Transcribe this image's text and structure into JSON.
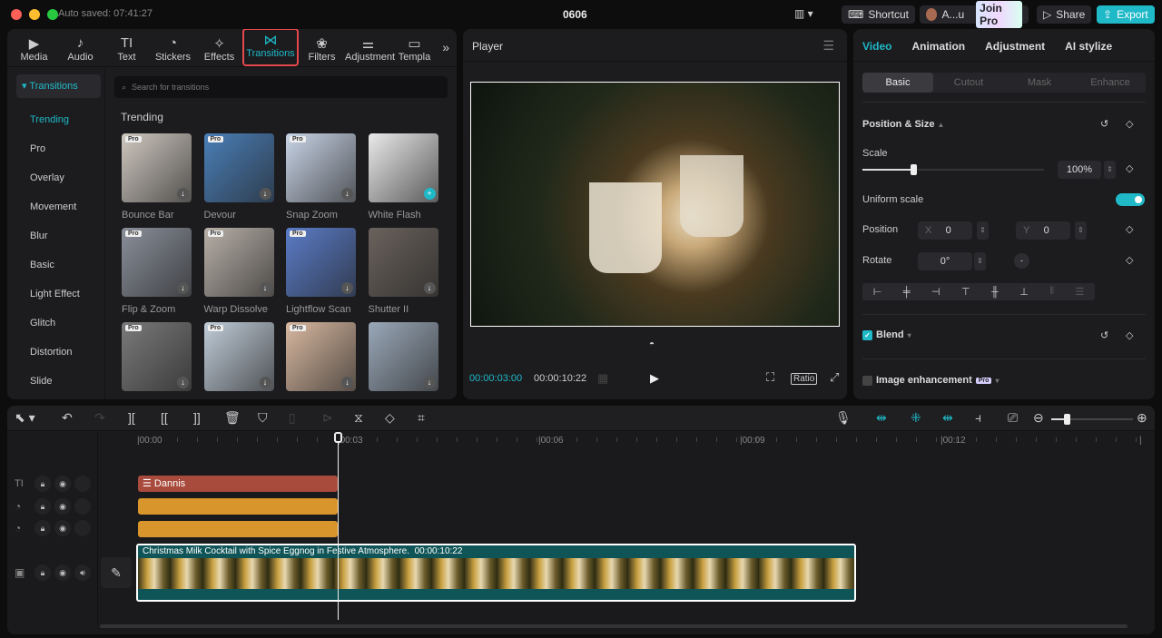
{
  "window": {
    "autosave": "Auto saved: 07:41:27",
    "title": "0606"
  },
  "topbar": {
    "shortcut": "Shortcut",
    "user": "A...u",
    "join_pro": "Join Pro",
    "share": "Share",
    "export": "Export"
  },
  "toolbar_tabs": [
    {
      "label": "Media",
      "icon": "▶"
    },
    {
      "label": "Audio",
      "icon": "♪"
    },
    {
      "label": "Text",
      "icon": "TI"
    },
    {
      "label": "Stickers",
      "icon": "◔"
    },
    {
      "label": "Effects",
      "icon": "✧"
    },
    {
      "label": "Transitions",
      "icon": "⋈",
      "active": true
    },
    {
      "label": "Filters",
      "icon": "❀"
    },
    {
      "label": "Adjustment",
      "icon": "⚌"
    },
    {
      "label": "Templa",
      "icon": "▭"
    }
  ],
  "sidebar": {
    "header": "Transitions",
    "items": [
      "Trending",
      "Pro",
      "Overlay",
      "Movement",
      "Blur",
      "Basic",
      "Light Effect",
      "Glitch",
      "Distortion",
      "Slide"
    ]
  },
  "search": {
    "placeholder": "Search for transitions"
  },
  "section_title": "Trending",
  "transitions": [
    {
      "name": "Bounce Bar",
      "pro": "Pro",
      "color": "#cfc8c0"
    },
    {
      "name": "Devour",
      "pro": "Pro",
      "color": "#4a7fb8"
    },
    {
      "name": "Snap Zoom",
      "pro": "Pro",
      "color": "#c8d4e6"
    },
    {
      "name": "White Flash",
      "pro": "",
      "color": "#eaeaea"
    },
    {
      "name": "Flip & Zoom",
      "pro": "Pro",
      "color": "#8a8f9a"
    },
    {
      "name": "Warp Dissolve",
      "pro": "Pro",
      "color": "#b8b0a8"
    },
    {
      "name": "Lightflow Scan",
      "pro": "Pro",
      "color": "#5a7cc8"
    },
    {
      "name": "Shutter II",
      "pro": "",
      "color": "#6a625c"
    },
    {
      "name": "",
      "pro": "Pro",
      "color": "#7a7a7a"
    },
    {
      "name": "",
      "pro": "Pro",
      "color": "#c0ccd8"
    },
    {
      "name": "",
      "pro": "Pro",
      "color": "#d8b8a0"
    },
    {
      "name": "",
      "pro": "",
      "color": "#9aa8b8"
    }
  ],
  "player": {
    "title": "Player",
    "current": "00:00:03:00",
    "total": "00:00:10:22",
    "ratio": "Ratio"
  },
  "inspector": {
    "tabs": [
      "Video",
      "Animation",
      "Adjustment",
      "AI stylize"
    ],
    "subtabs": [
      "Basic",
      "Cutout",
      "Mask",
      "Enhance"
    ],
    "pos_size": "Position & Size",
    "scale_label": "Scale",
    "scale_value": "100%",
    "scale_fraction": 0.28,
    "uniform": "Uniform scale",
    "uniform_on": true,
    "position": "Position",
    "x_label": "X",
    "x": "0",
    "y_label": "Y",
    "y": "0",
    "rotate": "Rotate",
    "rotate_value": "0°",
    "blend": "Blend",
    "enhance": "Image enhancement",
    "pro": "Pro"
  },
  "timeline": {
    "ticks": [
      "|00:00",
      "|00:03",
      "|00:06",
      "|00:09",
      "|00:12",
      "|"
    ],
    "text_clip": "Dannis",
    "video_clip": "Christmas Milk Cocktail with Spice Eggnog in Festive Atmosphere.",
    "video_duration": "00:00:10:22"
  },
  "colors": {
    "accent": "#1fb9c8",
    "text_clip": "#a84a3c",
    "effect_clip": "#d8952c",
    "video_clip": "#0f5558"
  }
}
